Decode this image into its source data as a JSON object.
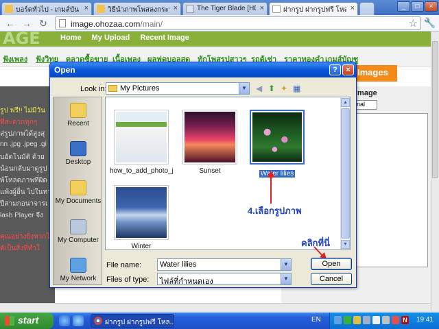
{
  "browser": {
    "tabs": [
      {
        "title": "บอร์ดทั่วไป - เกมส์บัน ",
        "active": false
      },
      {
        "title": "วิธีนำภาพโพสลงกระทู้ ",
        "active": false
      },
      {
        "title": "The Tiger Blade [HD] ",
        "active": false
      },
      {
        "title": "ฝากรูป ฝากรูปฟรี โหลด ",
        "active": true
      }
    ],
    "url_host": "image.ohozaa.com",
    "url_path": "/main/"
  },
  "page": {
    "logo": "AGE",
    "nav": [
      "Home",
      "My Upload",
      "Recent Image"
    ],
    "menu": [
      "ฟังเพลง",
      "ฟังวิทยุ",
      "ตลาดซื้อขาย",
      "เนื้อเพลง",
      "ผลฟุตบอลสด",
      "ทักโพสรูปสาวๆ",
      "รถตู้เช่า",
      "ราคาทองคำ",
      "เกมส์บัญชู"
    ],
    "left_lines": [
      {
        "text": "รูป ฟรี!! ไม่มีวัน",
        "color": "#e8e84a"
      },
      {
        "text": "ที่สะดวกทุกๆ",
        "color": "#ff4b4b"
      },
      {
        "text": "ส่รูปภาพได้สูงสุ",
        "color": "#dddddd"
      },
      {
        "text": "nn .jpg .jpeg .gi",
        "color": "#dddddd"
      },
      {
        "text": "บอัตโนมัติ ด้วย",
        "color": "#dddddd"
      },
      {
        "text": "น้อนกลับมาดูรูป",
        "color": "#dddddd"
      },
      {
        "text": "พ้โหลดภาพที่ผิด",
        "color": "#dddddd"
      },
      {
        "text": "แพ้งผู้อื่น ไปในทา",
        "color": "#dddddd"
      },
      {
        "text": "ปีสามกอนาจารเ",
        "color": "#dddddd"
      },
      {
        "text": "lash Player จึง",
        "color": "#dddddd"
      },
      {
        "text": "คุณอย่างยิ่งหากไ",
        "color": "#ff4b4b"
      },
      {
        "text": "ตัเป็นสิ่งที่ทำใ",
        "color": "#ff4b4b"
      }
    ],
    "images_button": "Images",
    "right_label": "Image",
    "right_select": "nal"
  },
  "dialog": {
    "title": "Open",
    "look_in_label": "Look in:",
    "look_in_value": "My Pictures",
    "places": [
      "Recent",
      "Desktop",
      "My Documents",
      "My Computer",
      "My Network"
    ],
    "files": [
      {
        "name": "how_to_add_photo_j...",
        "selected": false
      },
      {
        "name": "Sunset",
        "selected": false
      },
      {
        "name": "Water lilies",
        "selected": true
      },
      {
        "name": "Winter",
        "selected": false
      }
    ],
    "file_name_label": "File name:",
    "file_name_value": "Water lilies",
    "file_type_label": "Files of type:",
    "file_type_value": "ไฟล์ที่กำหนดเอง",
    "open_button": "Open",
    "cancel_button": "Cancel"
  },
  "annotations": {
    "step": "4.เลือกรูปภาพ",
    "click_here": "คลิกที่นี่",
    "color": "#2044c4",
    "arrow_color": "#e02020"
  },
  "taskbar": {
    "start": "start",
    "task_title": "ฝากรูป ฝากรูปฟรี โหล...",
    "language": "EN",
    "clock": "19:41"
  }
}
